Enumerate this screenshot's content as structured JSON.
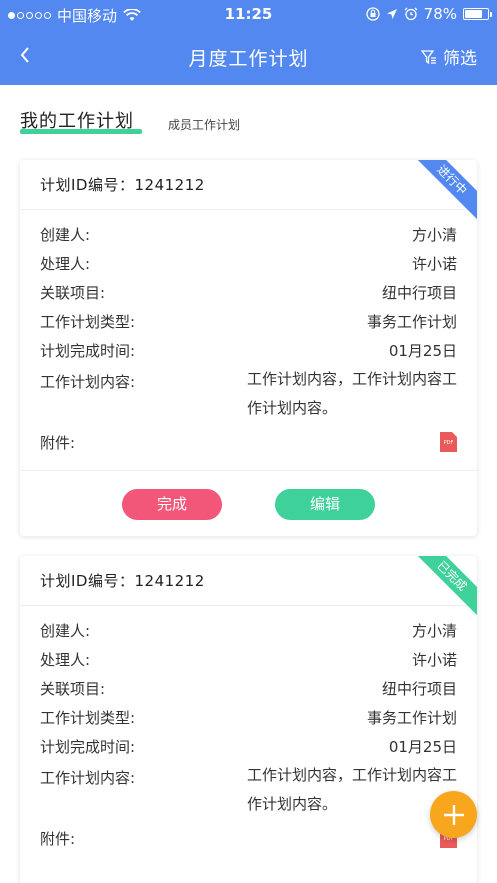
{
  "status_bar": {
    "carrier": "中国移动",
    "time": "11:25",
    "battery": "78%",
    "battery_level": 0.78
  },
  "nav": {
    "title": "月度工作计划",
    "filter_label": "筛选",
    "icons": [
      "back-arrow-icon",
      "filter-icon"
    ]
  },
  "tabs": {
    "active": "我的工作计划",
    "inactive": "成员工作计划",
    "underline_color": "#3ed19a"
  },
  "labels": {
    "id": "计划ID编号：",
    "creator": "创建人:",
    "handler": "处理人:",
    "project": "关联项目:",
    "type": "工作计划类型:",
    "due": "计划完成时间:",
    "content": "工作计划内容:",
    "attachment": "附件:"
  },
  "cards": [
    {
      "status": "进行中",
      "status_color": "#5288f0",
      "id": "1241212",
      "creator": "方小清",
      "handler": "许小诺",
      "project": "纽中行项目",
      "type": "事务工作计划",
      "due": "01月25日",
      "content": "工作计划内容，工作计划内容工作计划内容。",
      "attachment_icon": "pdf-icon",
      "actions": {
        "complete": "完成",
        "edit": "编辑"
      }
    },
    {
      "status": "已完成",
      "status_color": "#3ed19a",
      "id": "1241212",
      "creator": "方小清",
      "handler": "许小诺",
      "project": "纽中行项目",
      "type": "事务工作计划",
      "due": "01月25日",
      "content": "工作计划内容，工作计划内容工作计划内容。",
      "attachment_icon": "pdf-icon"
    }
  ],
  "fab": {
    "icon": "plus-icon",
    "color": "#f8a61d"
  },
  "colors": {
    "header": "#5288f0",
    "complete_button": "#f25779",
    "edit_button": "#3ed19a"
  }
}
